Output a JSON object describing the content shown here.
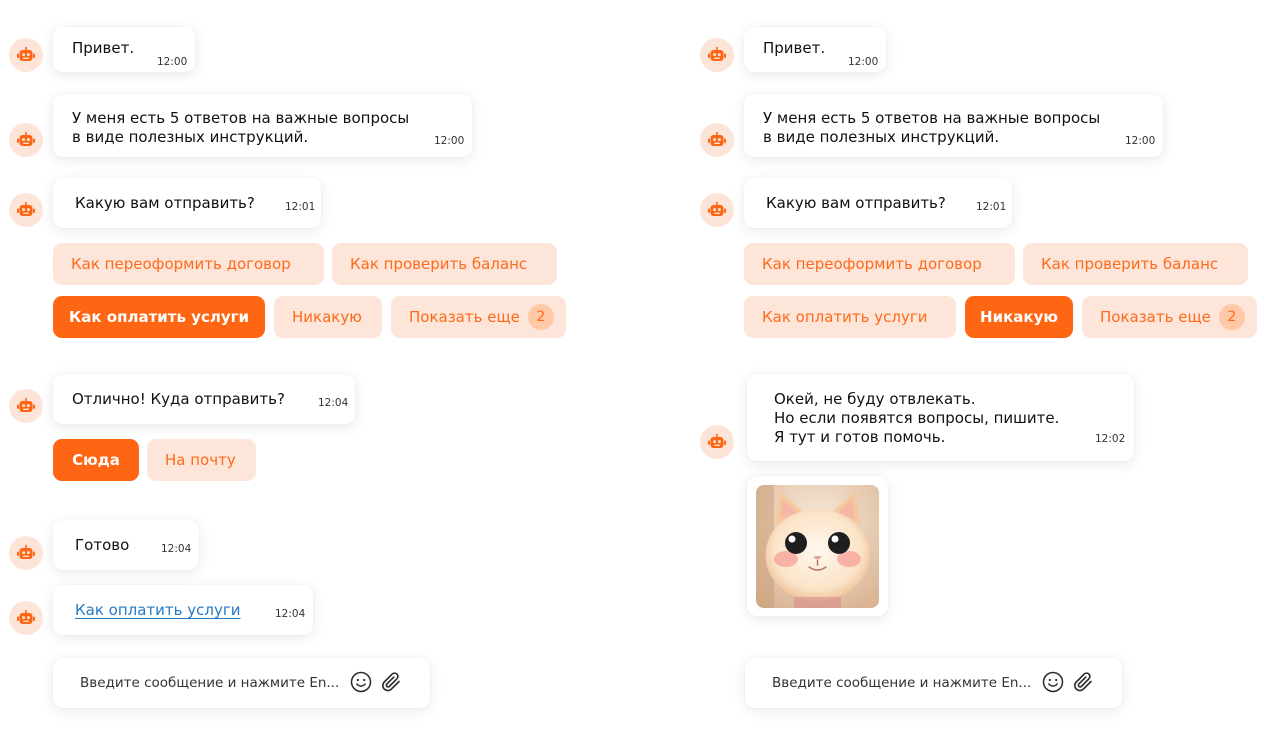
{
  "left": {
    "messages": [
      {
        "text": "Привет.",
        "time": "12:00"
      },
      {
        "text": "У меня есть 5 ответов на важные вопросы\nв виде полезных инструкций.",
        "time": "12:00"
      },
      {
        "text": "Какую вам отправить?",
        "time": "12:01"
      },
      {
        "text": "Отлично! Куда отправить?",
        "time": "12:04"
      },
      {
        "text": "Готово",
        "time": "12:04"
      },
      {
        "text": "Как оплатить услуги",
        "time": "12:04"
      }
    ],
    "options": [
      {
        "label": "Как переоформить договор",
        "selected": false
      },
      {
        "label": "Как проверить баланс",
        "selected": false
      },
      {
        "label": "Как оплатить услуги",
        "selected": true
      },
      {
        "label": "Никакую",
        "selected": false
      },
      {
        "label": "Показать еще",
        "count": "2",
        "selected": false
      }
    ],
    "destinations": [
      {
        "label": "Сюда",
        "selected": true
      },
      {
        "label": "На почту",
        "selected": false
      }
    ],
    "composer_placeholder": "Введите сообщение и нажмите En..."
  },
  "right": {
    "messages": [
      {
        "text": "Привет.",
        "time": "12:00"
      },
      {
        "text": "У меня есть 5 ответов на важные вопросы\nв виде полезных инструкций.",
        "time": "12:00"
      },
      {
        "text": "Какую вам отправить?",
        "time": "12:01"
      },
      {
        "text": "Окей, не буду отвлекать.\nНо если появятся вопросы, пишите.\nЯ тут и готов помочь.",
        "time": "12:02"
      }
    ],
    "options": [
      {
        "label": "Как переоформить договор",
        "selected": false
      },
      {
        "label": "Как проверить баланс",
        "selected": false
      },
      {
        "label": "Как оплатить услуги",
        "selected": false
      },
      {
        "label": "Никакую",
        "selected": true
      },
      {
        "label": "Показать еще",
        "count": "2",
        "selected": false
      }
    ],
    "composer_placeholder": "Введите сообщение и нажмите En..."
  },
  "icons": {
    "bot_avatar": "robot-icon",
    "emoji": "smiley-icon",
    "attach": "paperclip-icon",
    "image": "cat-photo"
  },
  "colors": {
    "accent": "#ff6613",
    "chip_bg": "#fde5d9",
    "chip_text": "#ff6a1a",
    "avatar_bg": "#fde4d8",
    "link": "#2679c6"
  }
}
